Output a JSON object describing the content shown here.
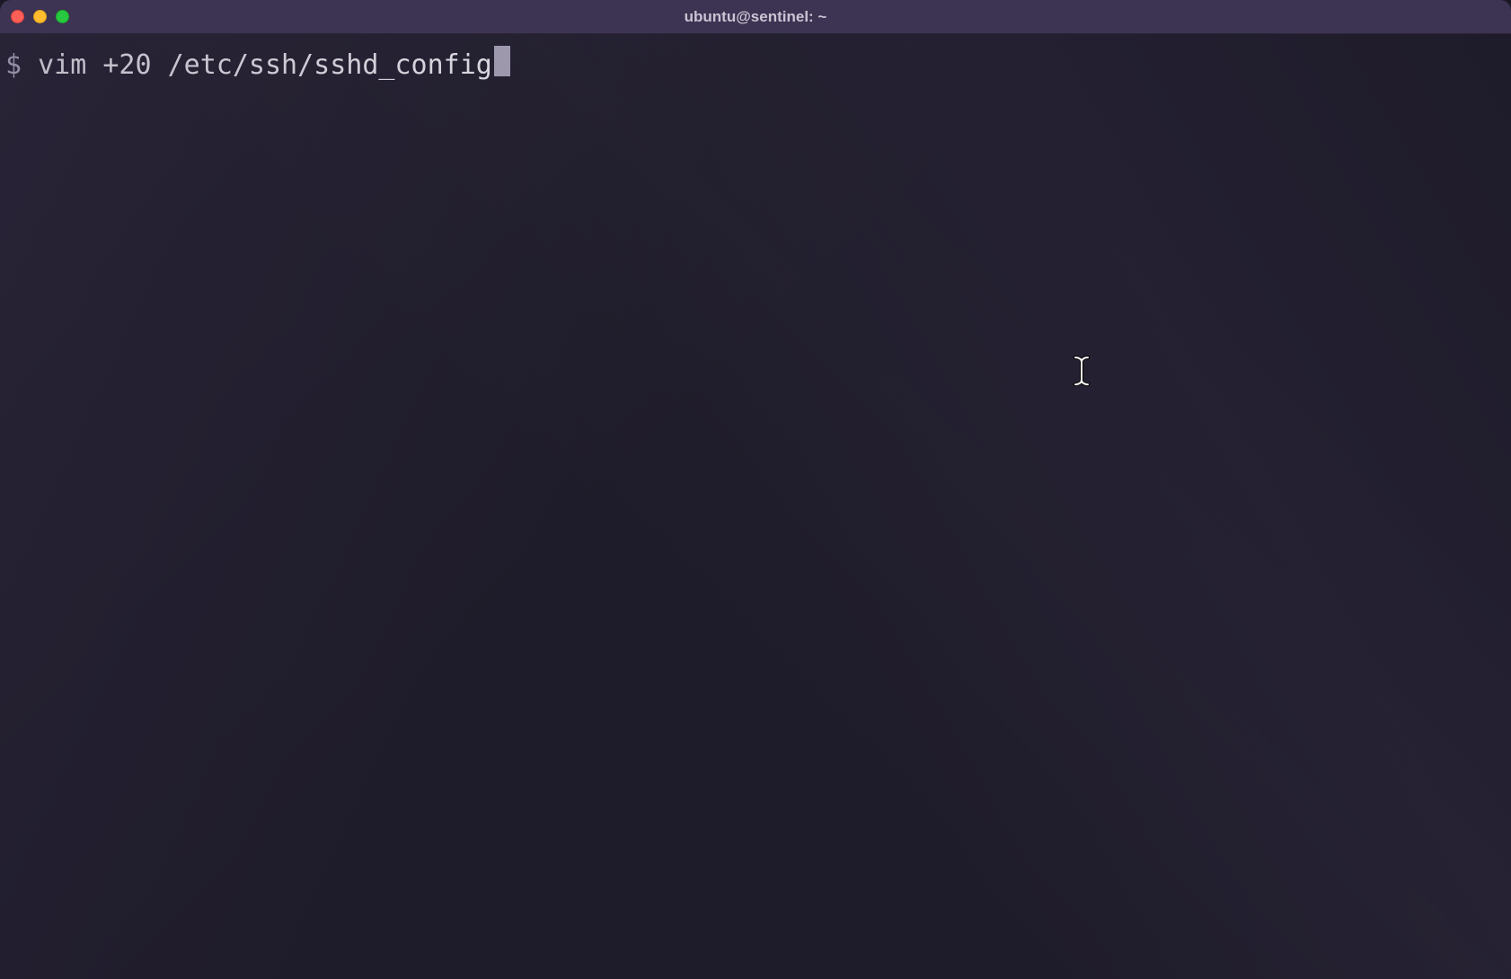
{
  "window": {
    "title": "ubuntu@sentinel: ~"
  },
  "terminal": {
    "prompt_symbol": "$",
    "command": " vim +20 /etc/ssh/sshd_config"
  },
  "icons": {
    "close": "close-icon",
    "minimize": "minimize-icon",
    "maximize": "maximize-icon",
    "ibeam": "text-cursor-icon"
  },
  "colors": {
    "titlebar_bg": "#3d3352",
    "terminal_bg": "#1e1b2a",
    "text": "#e8e6ed",
    "cursor_block": "#9e98ad",
    "close": "#ff5f57",
    "minimize": "#ffbd2e",
    "maximize": "#28c940"
  }
}
